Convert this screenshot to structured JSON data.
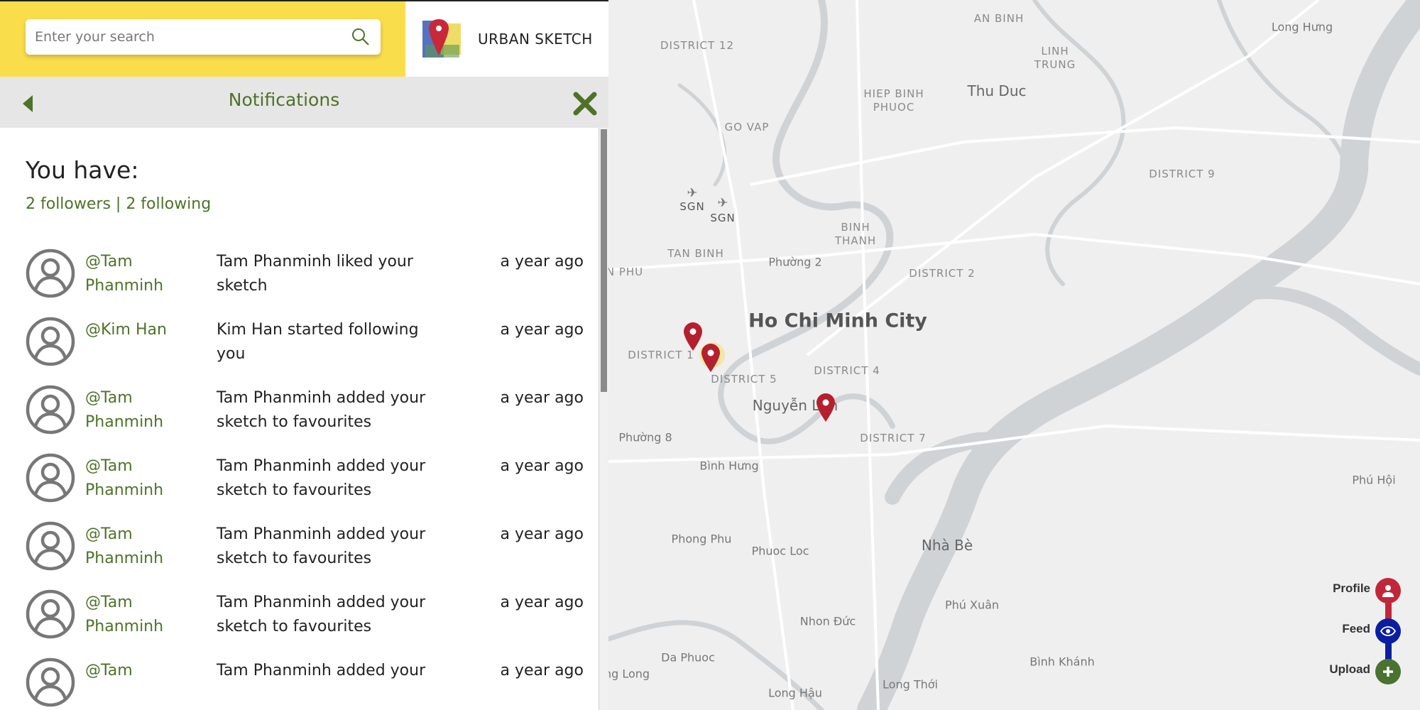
{
  "search": {
    "placeholder": "Enter your search",
    "icon": "search-icon"
  },
  "brand": {
    "name": "URBAN SKETCH"
  },
  "nav": {
    "title": "Notifications",
    "back_icon": "caret-left-icon",
    "close_icon": "close-icon"
  },
  "summary": {
    "heading": "You have:",
    "follow_text": "2 followers | 2 following"
  },
  "notifications": [
    {
      "user": "@Tam Phanminh",
      "text": "Tam Phanminh liked your sketch",
      "time": "a year ago"
    },
    {
      "user": "@Kim Han",
      "text": "Kim Han started following you",
      "time": "a year ago"
    },
    {
      "user": "@Tam Phanminh",
      "text": "Tam Phanminh added your sketch to favourites",
      "time": "a year ago"
    },
    {
      "user": "@Tam Phanminh",
      "text": "Tam Phanminh added your sketch to favourites",
      "time": "a year ago"
    },
    {
      "user": "@Tam Phanminh",
      "text": "Tam Phanminh added your sketch to favourites",
      "time": "a year ago"
    },
    {
      "user": "@Tam Phanminh",
      "text": "Tam Phanminh added your sketch to favourites",
      "time": "a year ago"
    },
    {
      "user": "@Tam",
      "text": "Tam Phanminh added your",
      "time": "a year ago"
    }
  ],
  "map": {
    "labels": {
      "an_binh": "AN BINH",
      "district12": "DISTRICT 12",
      "linh": "LINH",
      "trung": "TRUNG",
      "long_hung": "Long Hưng",
      "hiep_binh": "HIEP BINH",
      "phuoc": "PHUOC",
      "thu_duc": "Thu Duc",
      "go_vap": "GO VAP",
      "district9": "DISTRICT 9",
      "sgn1": "SGN",
      "sgn2": "SGN",
      "binh": "BINH",
      "thanh": "THANH",
      "tan_binh": "TAN BINH",
      "phuong2": "Phường 2",
      "district2": "DISTRICT 2",
      "n_phu": "N PHU",
      "city": "Ho Chi Minh City",
      "district1": "DISTRICT 1",
      "district5": "DISTRICT 5",
      "district4": "DISTRICT 4",
      "nguyen": "Nguyễn L  m",
      "phuong8": "Phường 8",
      "district7": "DISTRICT 7",
      "binh_hung": "Bình Hưng",
      "phu_hoi": "Phú Hội",
      "phong_phu": "Phong Phu",
      "phuoc_loc": "Phuoc Loc",
      "nha_be": "Nhà Bè",
      "phu_xuan": "Phú Xuân",
      "nhon_duc": "Nhon Đức",
      "da_phuoc": "Da Phuoc",
      "binh_khanh": "Bình Khánh",
      "ng_long": "ng Long",
      "long_thoi": "Long Thới",
      "long_hau": "Long Hậu"
    }
  },
  "menu": {
    "profile": {
      "label": "Profile",
      "color": "#c0283a",
      "icon": "user-icon"
    },
    "feed": {
      "label": "Feed",
      "color": "#0a1fa0",
      "icon": "eye-icon"
    },
    "upload": {
      "label": "Upload",
      "color": "#4a7230",
      "icon": "plus-icon"
    }
  },
  "colors": {
    "accent": "#4e7228",
    "header": "#f9dd4b",
    "marker": "#b5202e"
  }
}
